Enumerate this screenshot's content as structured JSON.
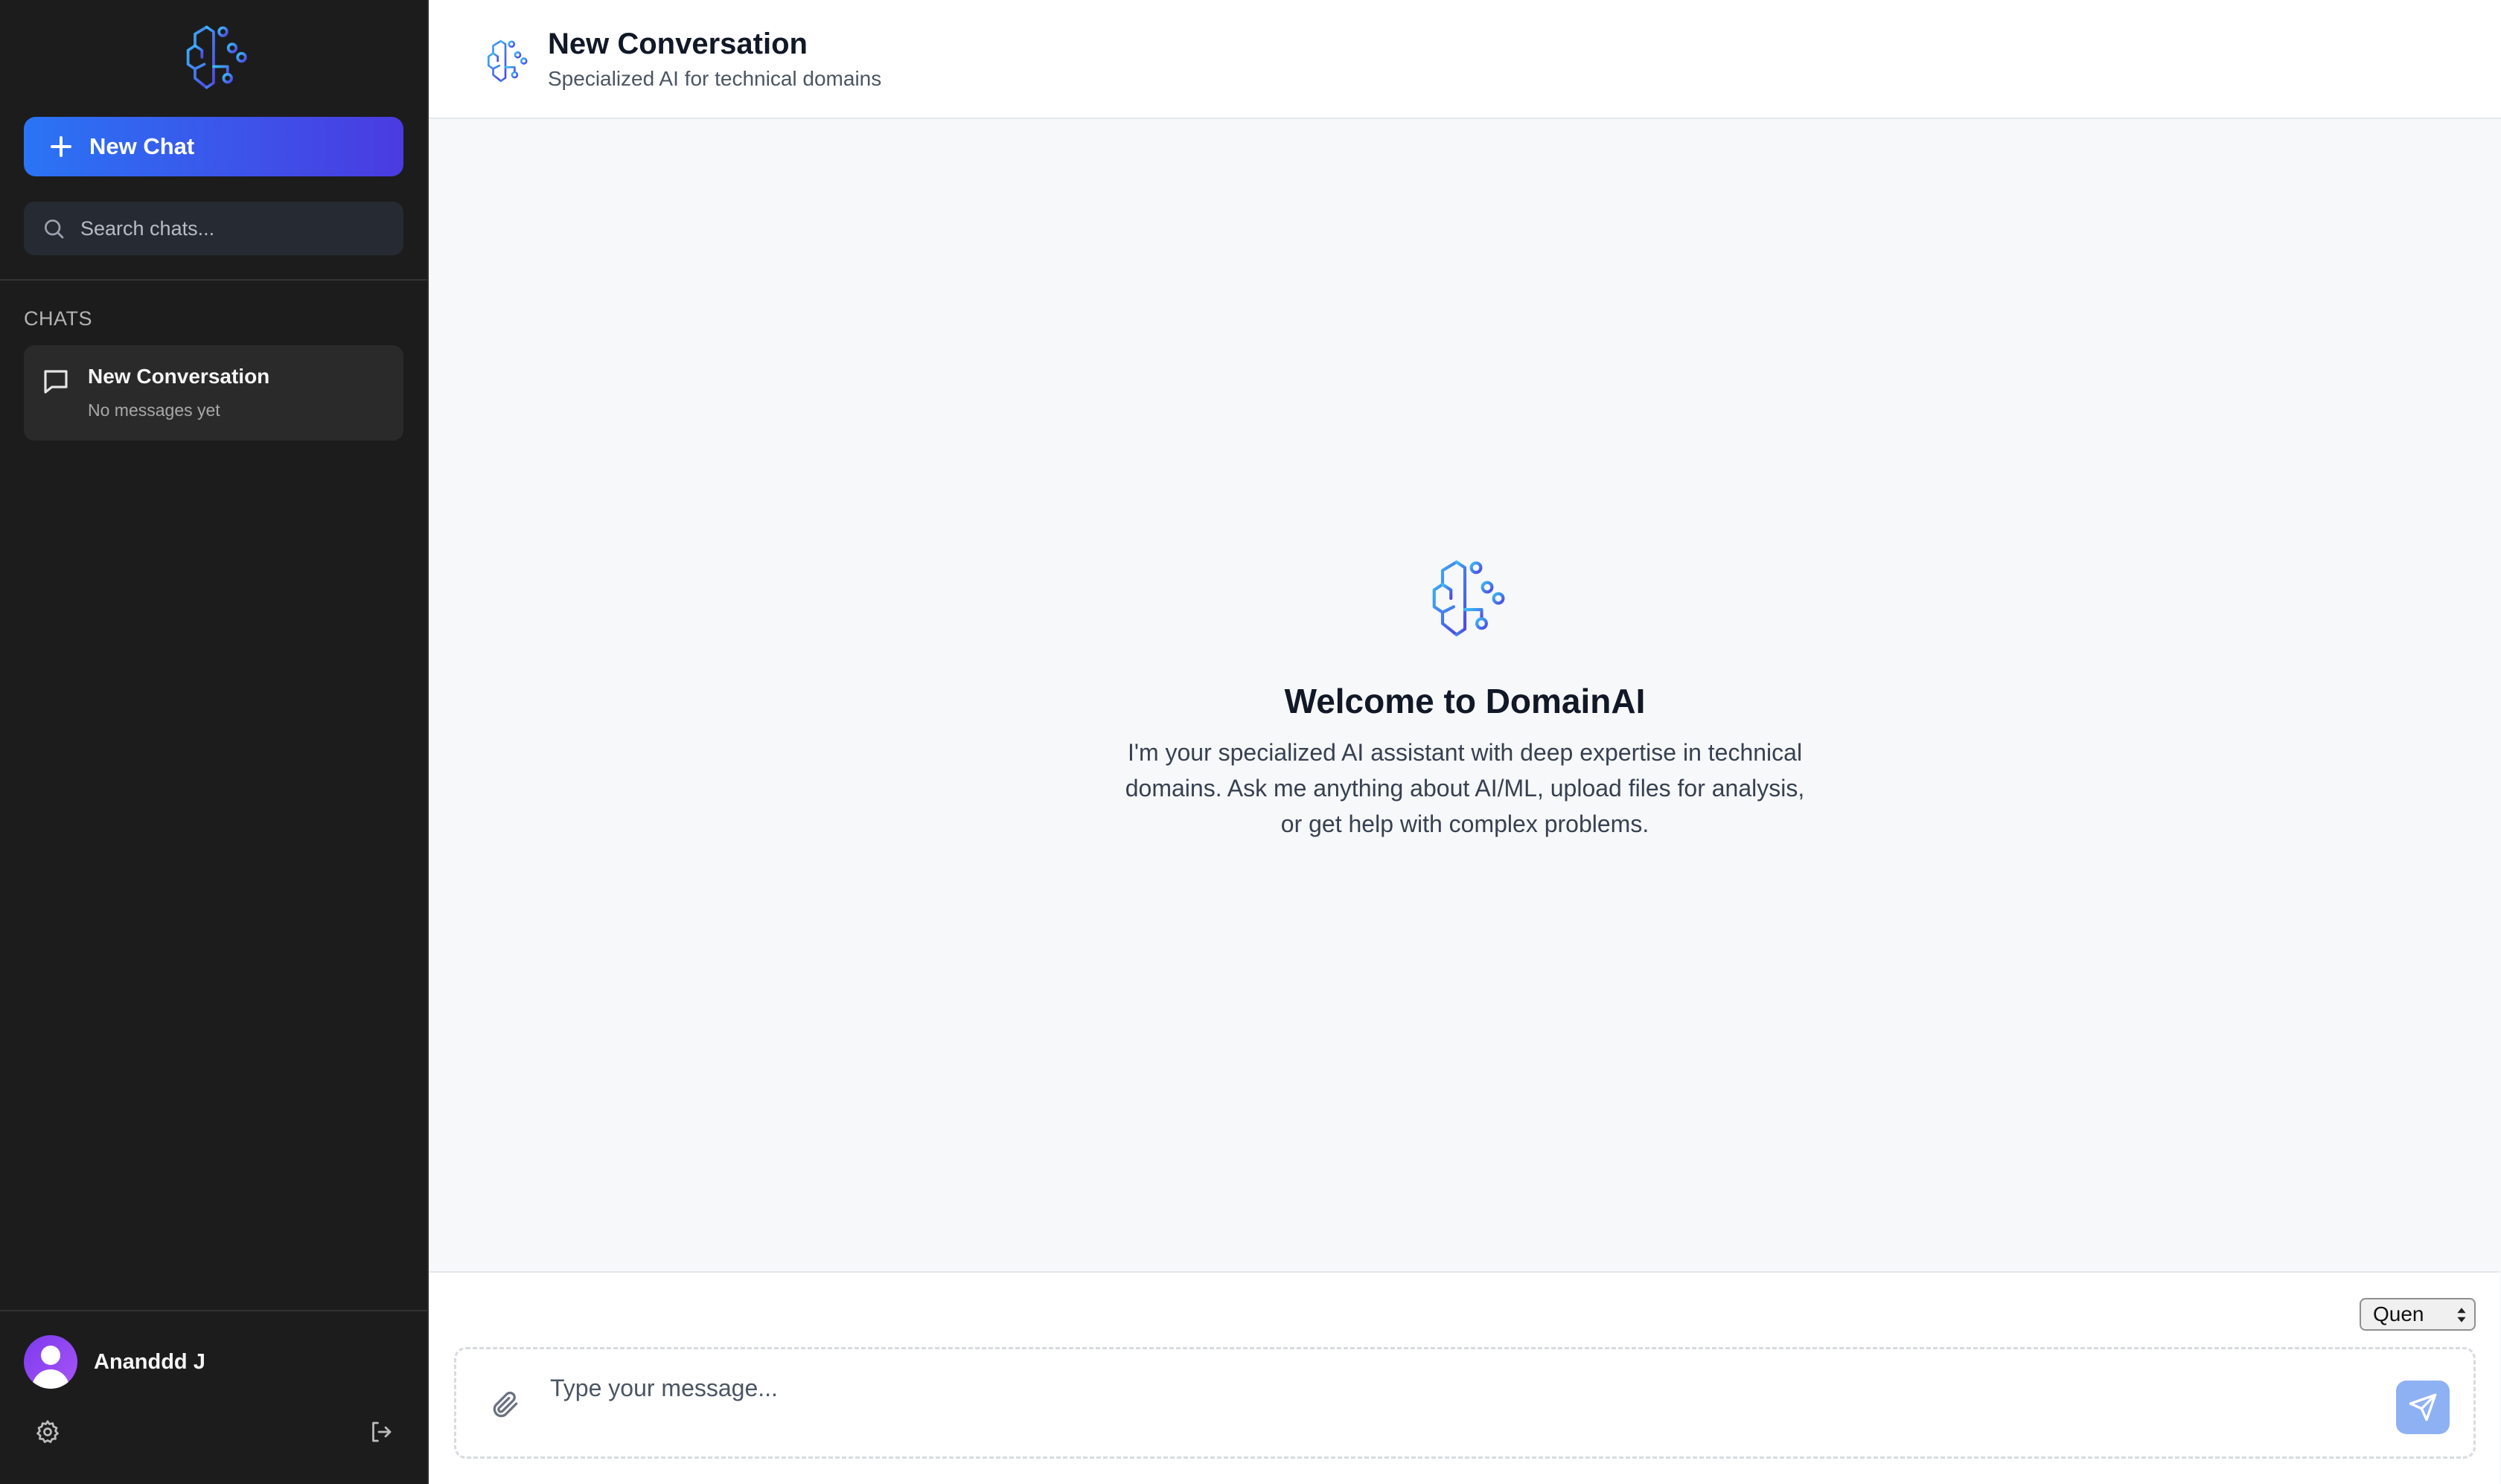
{
  "sidebar": {
    "logo_icon": "brain-circuit-icon",
    "new_chat_label": "New Chat",
    "search_placeholder": "Search chats...",
    "section_label": "CHATS",
    "chats": [
      {
        "title": "New Conversation",
        "subtitle": "No messages yet"
      }
    ],
    "user": {
      "name": "Ananddd J"
    },
    "settings_icon": "gear-icon",
    "logout_icon": "logout-icon"
  },
  "header": {
    "title": "New Conversation",
    "subtitle": "Specialized AI for technical domains"
  },
  "welcome": {
    "title": "Welcome to DomainAI",
    "text": "I'm your specialized AI assistant with deep expertise in technical domains. Ask me anything about AI/ML, upload files for analysis, or get help with complex problems."
  },
  "composer": {
    "model_selected": "Quen",
    "placeholder": "Type your message...",
    "attach_icon": "paperclip-icon",
    "send_icon": "send-icon"
  },
  "colors": {
    "accent_start": "#2a74f5",
    "accent_end": "#4a3be0",
    "sidebar_bg": "#1c1c1c",
    "send_button": "#8db1f3"
  }
}
